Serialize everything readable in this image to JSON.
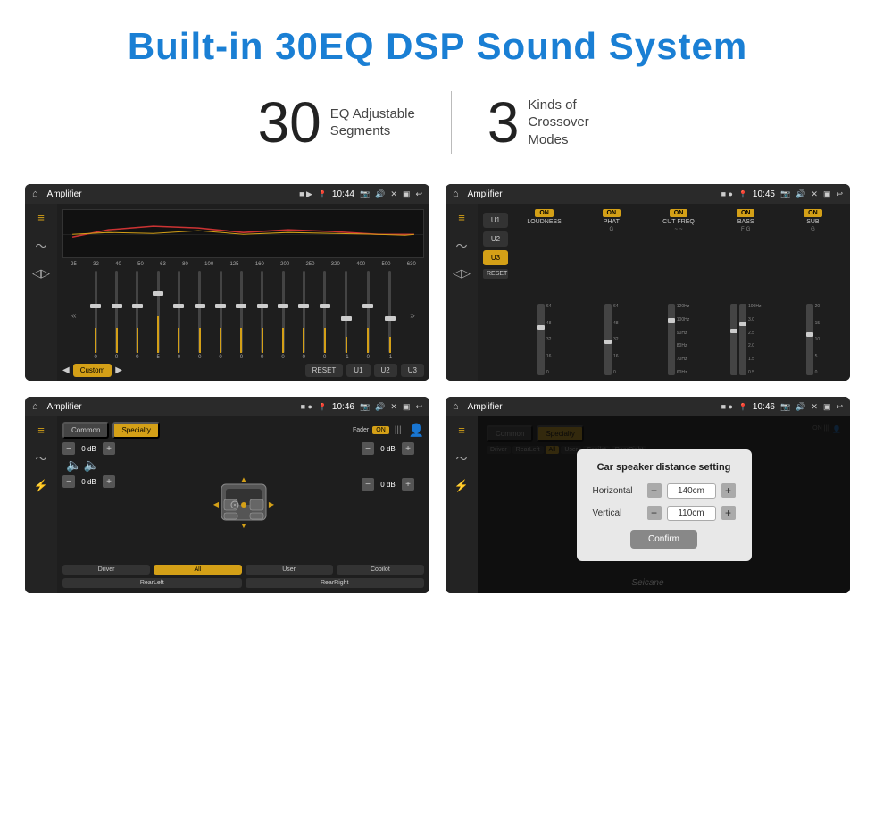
{
  "header": {
    "title": "Built-in 30EQ DSP Sound System"
  },
  "stats": [
    {
      "number": "30",
      "label": "EQ Adjustable\nSegments"
    },
    {
      "number": "3",
      "label": "Kinds of\nCrossover Modes"
    }
  ],
  "screens": [
    {
      "id": "screen-eq",
      "status": {
        "title": "Amplifier",
        "time": "10:44"
      },
      "type": "equalizer",
      "freqs": [
        "25",
        "32",
        "40",
        "50",
        "63",
        "80",
        "100",
        "125",
        "160",
        "200",
        "250",
        "320",
        "400",
        "500",
        "630"
      ],
      "values": [
        "0",
        "0",
        "0",
        "5",
        "0",
        "0",
        "0",
        "0",
        "0",
        "0",
        "0",
        "0",
        "-1",
        "0",
        "-1"
      ],
      "presets": [
        "Custom",
        "RESET",
        "U1",
        "U2",
        "U3"
      ],
      "activePreset": "Custom"
    },
    {
      "id": "screen-crossover",
      "status": {
        "title": "Amplifier",
        "time": "10:45"
      },
      "type": "crossover",
      "presets": [
        "U1",
        "U2",
        "U3"
      ],
      "activePreset": "U3",
      "channels": [
        {
          "name": "LOUDNESS",
          "on": true
        },
        {
          "name": "PHAT",
          "on": true
        },
        {
          "name": "CUT FREQ",
          "on": true
        },
        {
          "name": "BASS",
          "on": true
        },
        {
          "name": "SUB",
          "on": true
        }
      ],
      "resetLabel": "RESET"
    },
    {
      "id": "screen-speaker",
      "status": {
        "title": "Amplifier",
        "time": "10:46"
      },
      "type": "speaker",
      "buttons": [
        "Common",
        "Specialty"
      ],
      "activeBtn": "Specialty",
      "faderLabel": "Fader",
      "faderOn": "ON",
      "volumes": [
        {
          "label": "",
          "value": "0 dB"
        },
        {
          "label": "",
          "value": "0 dB"
        },
        {
          "label": "",
          "value": "0 dB"
        },
        {
          "label": "",
          "value": "0 dB"
        }
      ],
      "positions": [
        "Driver",
        "RearLeft",
        "All",
        "User",
        "Copilot",
        "RearRight"
      ],
      "activePosition": "All"
    },
    {
      "id": "screen-dialog",
      "status": {
        "title": "Amplifier",
        "time": "10:46"
      },
      "type": "speaker-dialog",
      "dialog": {
        "title": "Car speaker distance setting",
        "horizontal": {
          "label": "Horizontal",
          "value": "140cm"
        },
        "vertical": {
          "label": "Vertical",
          "value": "110cm"
        },
        "confirmLabel": "Confirm"
      }
    }
  ],
  "watermark": "Seicane"
}
